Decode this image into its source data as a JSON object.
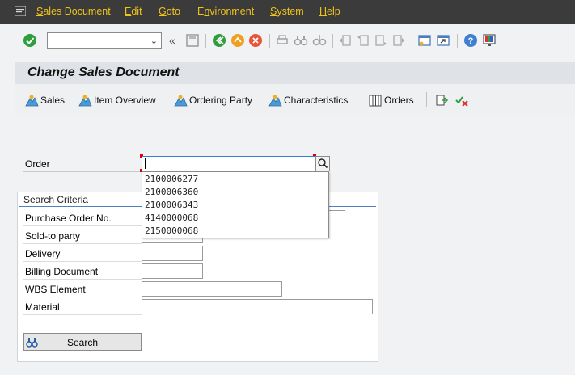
{
  "menubar": {
    "items": [
      "Sales Document",
      "Edit",
      "Goto",
      "Environment",
      "System",
      "Help"
    ],
    "underline": [
      "S",
      "E",
      "G",
      "n",
      "S",
      "H"
    ]
  },
  "toolbar": {
    "command_field_value": "",
    "command_field_icon": "chevron-down-icon",
    "icons": [
      "enter-icon",
      "save-icon",
      "back-icon",
      "exit-icon",
      "cancel-icon",
      "print-icon",
      "find-icon",
      "find-next-icon",
      "first-page-icon",
      "previous-page-icon",
      "next-page-icon",
      "last-page-icon",
      "create-session-icon",
      "shortcut-icon",
      "help-icon",
      "customize-layout-icon"
    ]
  },
  "title": "Change Sales Document",
  "app_toolbar": {
    "buttons": [
      "Sales",
      "Item Overview",
      "Ordering Party",
      "Characteristics",
      "Orders"
    ]
  },
  "order": {
    "label": "Order",
    "value": "",
    "history": [
      "2100006277",
      "2100006360",
      "2100006343",
      "4140000068",
      "2150000068"
    ]
  },
  "search_criteria": {
    "title": "Search Criteria",
    "fields": [
      {
        "label": "Purchase Order No.",
        "value": ""
      },
      {
        "label": "Sold-to party",
        "value": ""
      },
      {
        "label": "Delivery",
        "value": ""
      },
      {
        "label": "Billing Document",
        "value": ""
      },
      {
        "label": "WBS Element",
        "value": ""
      },
      {
        "label": "Material",
        "value": ""
      }
    ],
    "search_button": "Search"
  },
  "colors": {
    "menubar_bg": "#3b3b3b",
    "menu_text": "#f0c419",
    "title_bar": "#dfe3e8",
    "focus_border": "#3a7bd5",
    "required_corner": "#dd0000"
  }
}
